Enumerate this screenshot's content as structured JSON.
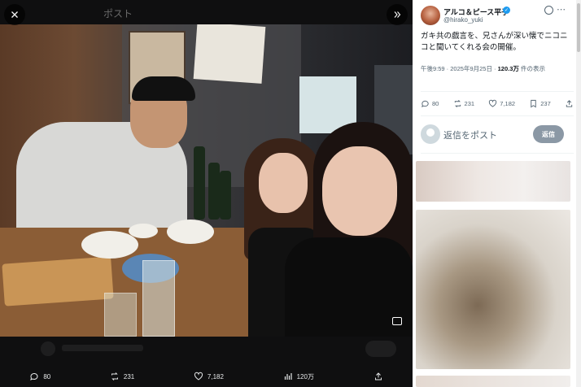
{
  "viewer": {
    "close_icon": "close-icon",
    "expand_icon": "expand-icon",
    "topbar_faint": [
      "ポスト"
    ],
    "stats": {
      "replies": "80",
      "reposts": "231",
      "likes": "7,182",
      "views": "120万"
    }
  },
  "post": {
    "author_name": "アルコ＆ピース平子",
    "handle": "@hirako_yuki",
    "text": "ガキ共の戯言を、兄さんが深い懐でニコニコと聞いてくれる会の開催。",
    "time": "午後9:59 · 2025年9月25日 · ",
    "views_count": "120.3万",
    "views_label": " 件の表示",
    "stats": {
      "replies": "80",
      "reposts": "231",
      "likes": "7,182",
      "bookmarks": "237"
    }
  },
  "reply": {
    "placeholder": "返信をポスト",
    "button_label": "返信"
  },
  "colors": {
    "accent": "#1d9bf0",
    "reply_button": "#8b98a5",
    "viewer_bg": "#0f0f10"
  }
}
